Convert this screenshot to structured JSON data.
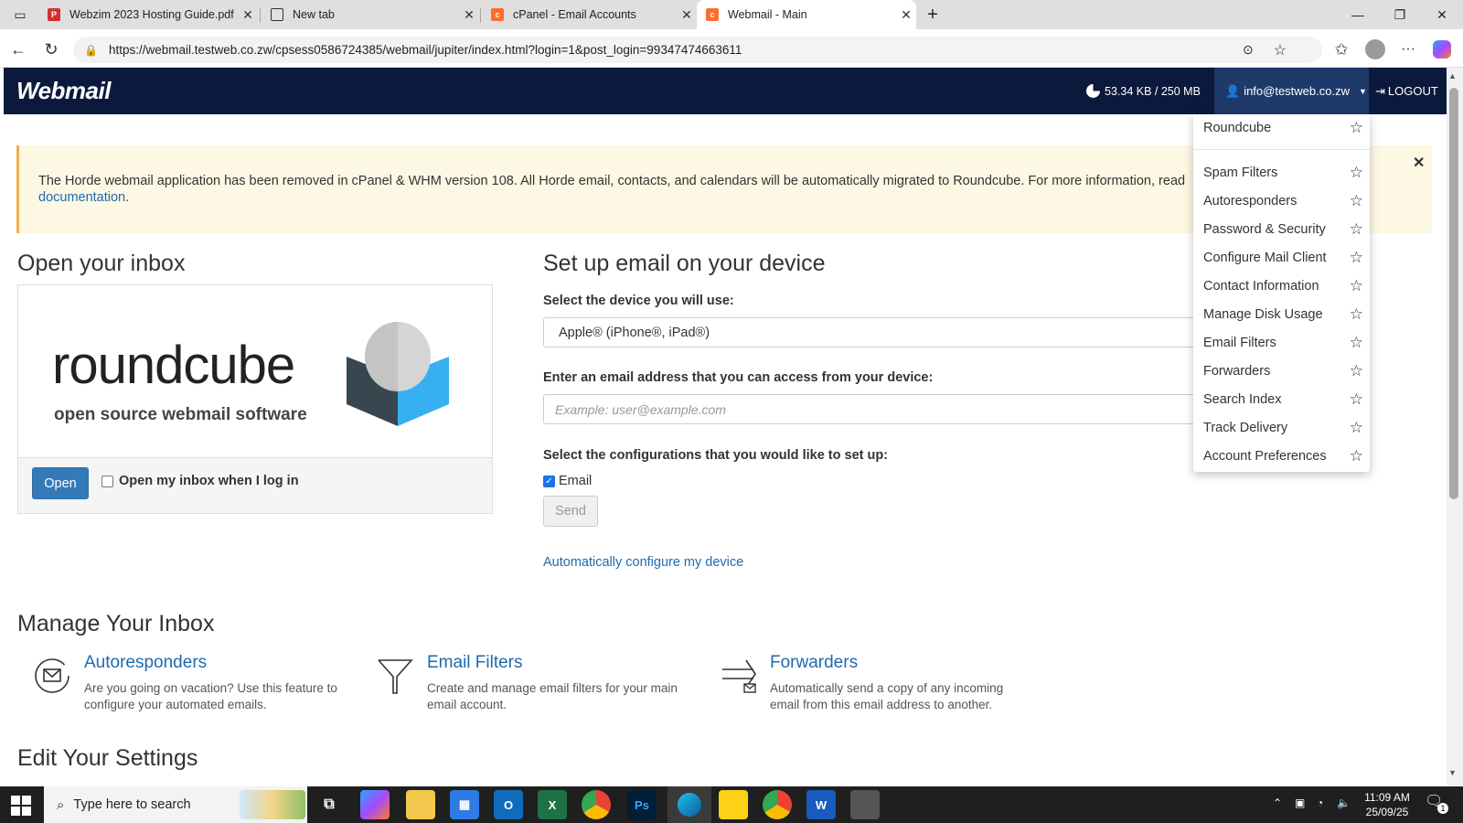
{
  "browser": {
    "tabs": [
      {
        "title": "Webzim 2023 Hosting Guide.pdf",
        "icon": "pdf-icon"
      },
      {
        "title": "New tab",
        "icon": "newtab-icon"
      },
      {
        "title": "cPanel - Email Accounts",
        "icon": "cpanel-icon"
      },
      {
        "title": "Webmail - Main",
        "icon": "cpanel-icon",
        "active": true
      }
    ],
    "url": "https://webmail.testweb.co.zw/cpsess0586724385/webmail/jupiter/index.html?login=1&post_login=99347474663611"
  },
  "header": {
    "logo": "Webmail",
    "disk_usage": "53.34 KB / 250 MB",
    "user": "info@testweb.co.zw",
    "logout": "LOGOUT"
  },
  "alert": {
    "text": "The Horde webmail application has been removed in cPanel & WHM version 108. All Horde email, contacts, and calendars will be automatically migrated to Roundcube. For more information, read",
    "link": "documentation",
    "after": "."
  },
  "inbox": {
    "heading": "Open your inbox",
    "logo_word": "roundcube",
    "logo_tagline": "open source webmail software",
    "open_button": "Open",
    "checkbox_label": "Open my inbox when I log in"
  },
  "setup": {
    "heading": "Set up email on your device",
    "device_label": "Select the device you will use:",
    "device_value": "Apple® (iPhone®, iPad®)",
    "email_label": "Enter an email address that you can access from your device:",
    "email_placeholder": "Example: user@example.com",
    "config_label": "Select the configurations that you would like to set up:",
    "config_email": "Email",
    "send_button": "Send",
    "auto_link": "Automatically configure my device"
  },
  "dropdown": {
    "items": [
      "Roundcube",
      "Spam Filters",
      "Autoresponders",
      "Password & Security",
      "Configure Mail Client",
      "Contact Information",
      "Manage Disk Usage",
      "Email Filters",
      "Forwarders",
      "Search Index",
      "Track Delivery",
      "Account Preferences"
    ]
  },
  "manage": {
    "heading": "Manage Your Inbox",
    "cards": [
      {
        "title": "Autoresponders",
        "desc": "Are you going on vacation? Use this feature to configure your automated emails.",
        "icon": "autoresponder-icon"
      },
      {
        "title": "Email Filters",
        "desc": "Create and manage email filters for your main email account.",
        "icon": "filter-icon"
      },
      {
        "title": "Forwarders",
        "desc": "Automatically send a copy of any incoming email from this email address to another.",
        "icon": "forward-icon"
      }
    ]
  },
  "settings": {
    "heading": "Edit Your Settings"
  },
  "taskbar": {
    "search_placeholder": "Type here to search",
    "time": "11:09 AM",
    "date": "25/09/25",
    "notifications": "1"
  },
  "colors": {
    "header_bg": "#0b1a3c",
    "link": "#1e6aae",
    "primary": "#337ab7",
    "alert_bg": "#fcf8e3"
  }
}
